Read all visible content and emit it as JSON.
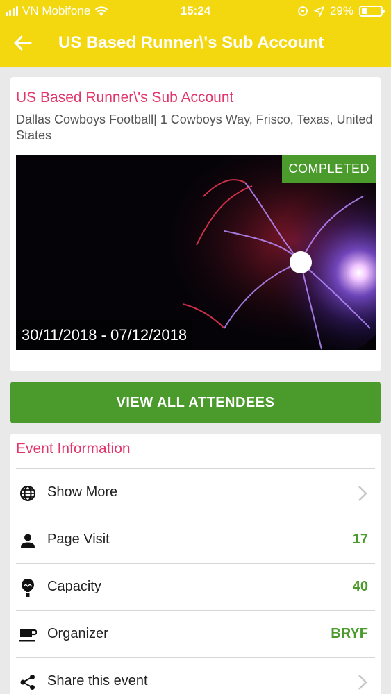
{
  "status_bar": {
    "carrier": "VN Mobifone",
    "time": "15:24",
    "battery_percent": "29%",
    "battery_level": 0.29
  },
  "nav": {
    "title": "US Based Runner\\'s Sub Account",
    "back_icon": "arrow-left-icon"
  },
  "event": {
    "title": "US Based Runner\\'s Sub Account",
    "address": "Dallas Cowboys Football| 1 Cowboys Way, Frisco, Texas, United States",
    "status": "COMPLETED",
    "date_range": "30/11/2018 - 07/12/2018",
    "image": "plasma-ball-photo"
  },
  "attendees_button": {
    "label": "VIEW ALL ATTENDEES"
  },
  "info": {
    "heading": "Event Information",
    "rows": [
      {
        "icon": "globe-icon",
        "label": "Show More",
        "value": "",
        "chevron": true
      },
      {
        "icon": "person-icon",
        "label": "Page Visit",
        "value": "17",
        "chevron": false
      },
      {
        "icon": "balloon-icon",
        "label": "Capacity",
        "value": "40",
        "chevron": false
      },
      {
        "icon": "coffee-cup-icon",
        "label": "Organizer",
        "value": "BRYF",
        "chevron": false
      },
      {
        "icon": "share-icon",
        "label": "Share this event",
        "value": "",
        "chevron": true
      }
    ]
  },
  "colors": {
    "header": "#f4d80f",
    "accent_pink": "#e1356b",
    "accent_green": "#4a9a2c",
    "background": "#e9e9e9"
  }
}
